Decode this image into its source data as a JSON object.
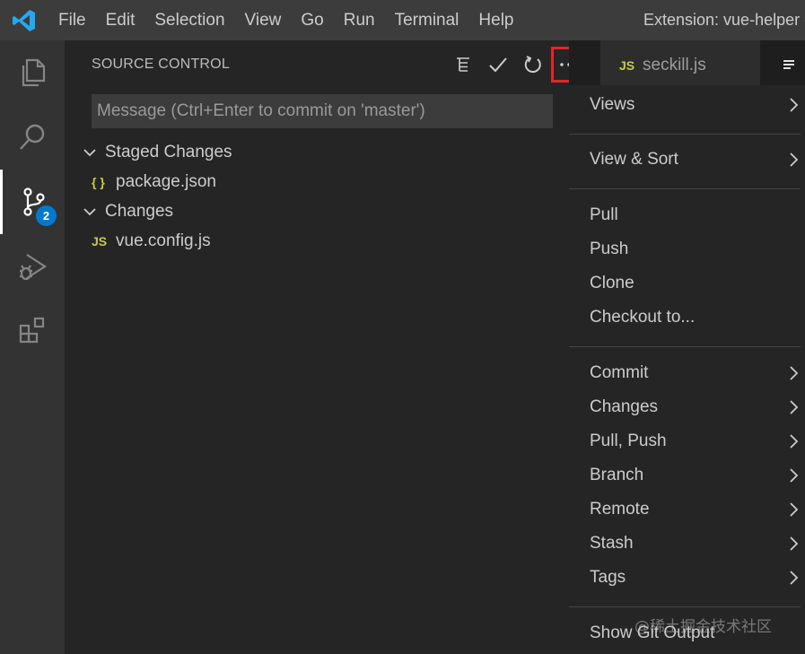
{
  "titlebar": {
    "app_icon": "vscode-logo-icon",
    "menu": [
      "File",
      "Edit",
      "Selection",
      "View",
      "Go",
      "Run",
      "Terminal",
      "Help"
    ],
    "window_title": "Extension: vue-helper -"
  },
  "activity_bar": {
    "items": [
      {
        "icon": "explorer-files-icon"
      },
      {
        "icon": "search-icon"
      },
      {
        "icon": "source-control-icon",
        "badge": "2",
        "active": true
      },
      {
        "icon": "run-debug-icon"
      },
      {
        "icon": "extensions-icon"
      }
    ]
  },
  "source_control": {
    "header": "SOURCE CONTROL",
    "toolbar_icons": [
      "view-as-tree-icon",
      "commit-check-icon",
      "refresh-icon",
      "more-actions-icon"
    ],
    "commit_placeholder": "Message (Ctrl+Enter to commit on 'master')",
    "staged_label": "Staged Changes",
    "staged_files": [
      {
        "icon_text": "{ }",
        "name": "package.json"
      }
    ],
    "changes_label": "Changes",
    "changed_files": [
      {
        "icon_text": "JS",
        "name": "vue.config.js"
      }
    ]
  },
  "editor_tabs": [
    {
      "icon_text": "JS",
      "label": "seckill.js",
      "active": false
    },
    {
      "icon": "lines-icon",
      "active": true
    }
  ],
  "context_menu": {
    "groups": [
      [
        {
          "label": "Views",
          "submenu": true
        }
      ],
      [
        {
          "label": "View & Sort",
          "submenu": true
        }
      ],
      [
        {
          "label": "Pull"
        },
        {
          "label": "Push"
        },
        {
          "label": "Clone"
        },
        {
          "label": "Checkout to..."
        }
      ],
      [
        {
          "label": "Commit",
          "submenu": true
        },
        {
          "label": "Changes",
          "submenu": true
        },
        {
          "label": "Pull, Push",
          "submenu": true
        },
        {
          "label": "Branch",
          "submenu": true
        },
        {
          "label": "Remote",
          "submenu": true
        },
        {
          "label": "Stash",
          "submenu": true
        },
        {
          "label": "Tags",
          "submenu": true
        }
      ],
      [
        {
          "label": "Show Git Output"
        }
      ]
    ]
  },
  "watermark": "@稀土掘金技术社区",
  "colors": {
    "accent_badge": "#007acc",
    "highlight_box": "#e8232a",
    "vscode_logo": "#23a9f2",
    "json_icon": "#cbcb41",
    "js_icon": "#cbcb41"
  }
}
